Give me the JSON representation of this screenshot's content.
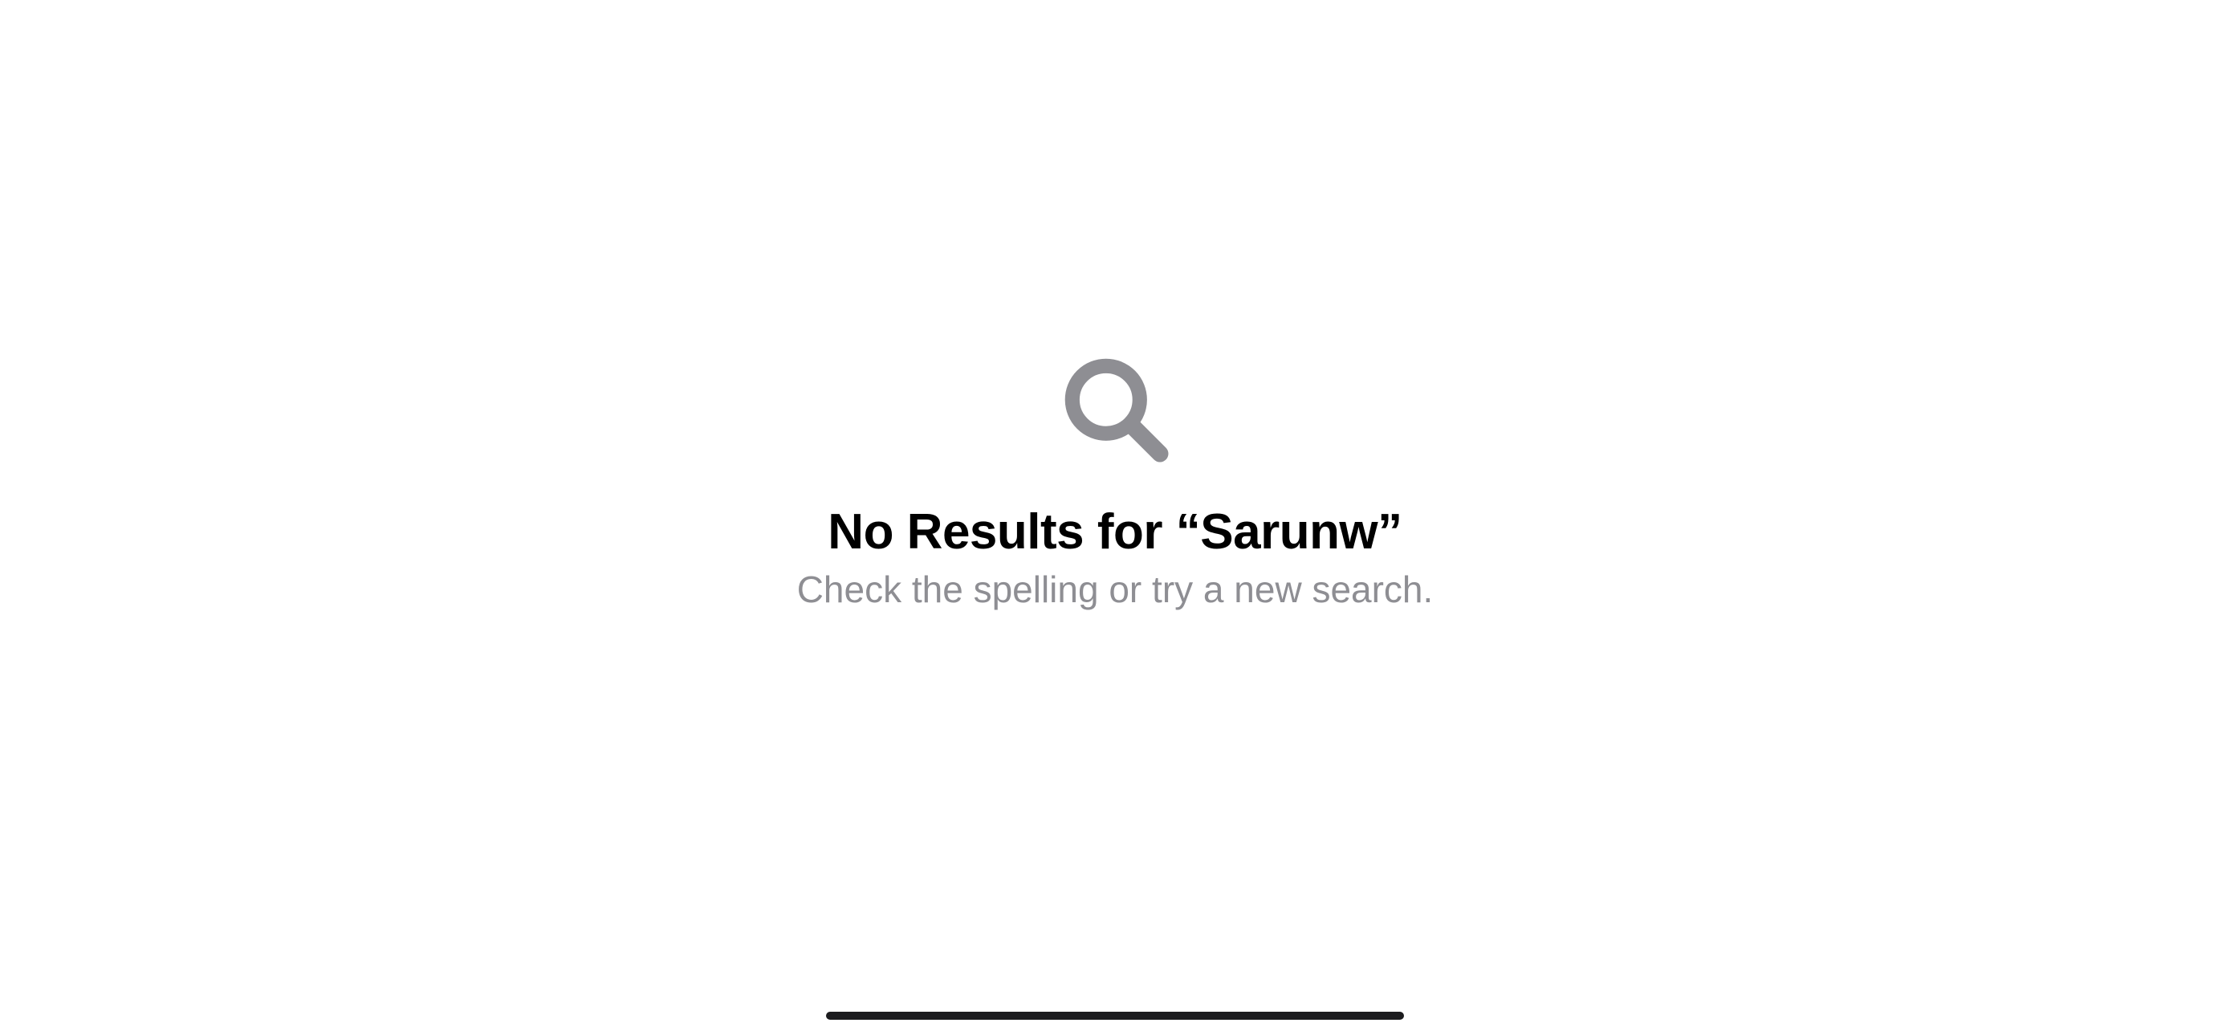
{
  "emptyState": {
    "title": "No Results for “Sarunw”",
    "subtitle": "Check the spelling or try a new search.",
    "iconName": "search-icon"
  }
}
